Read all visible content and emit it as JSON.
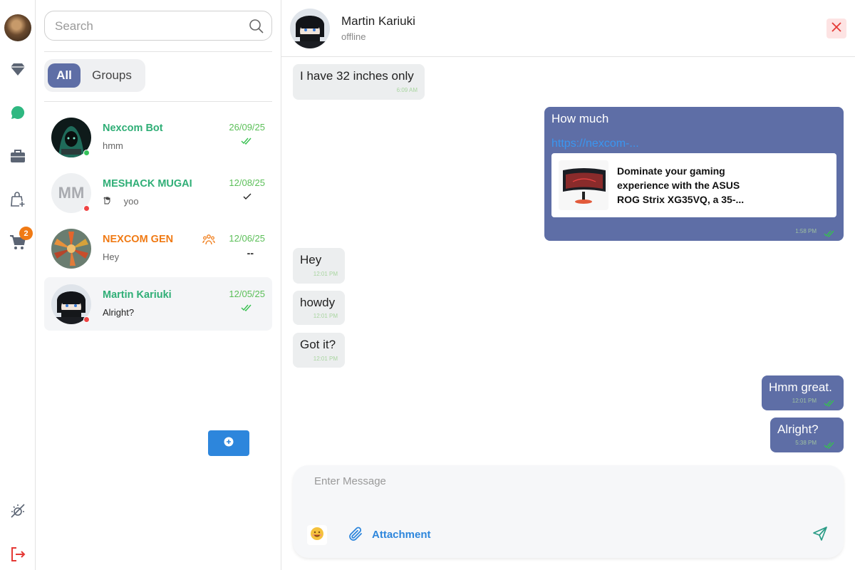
{
  "rail": {
    "cart_badge": "2"
  },
  "search": {
    "placeholder": "Search"
  },
  "tabs": {
    "all": "All",
    "groups": "Groups"
  },
  "chats": [
    {
      "name": "Nexcom Bot",
      "message": "hmm",
      "date": "26/09/25",
      "status": "read",
      "presence": "online",
      "name_color": "#2fae76"
    },
    {
      "name": "MESHACK MUGAI",
      "initials": "MM",
      "message": "yoo",
      "date": "12/08/25",
      "status": "sent",
      "presence": "offline",
      "name_color": "#2fae76"
    },
    {
      "name": "NEXCOM GEN",
      "message": "Hey",
      "date": "12/06/25",
      "status": "--",
      "is_group": true,
      "name_color": "#f07a14"
    },
    {
      "name": "Martin Kariuki",
      "message": "Alright?",
      "date": "12/05/25",
      "status": "read",
      "presence": "offline",
      "name_color": "#2fae76",
      "active": true
    }
  ],
  "conversation": {
    "contact_name": "Martin Kariuki",
    "contact_status": "offline",
    "messages": [
      {
        "dir": "in",
        "text": "I have 32 inches only",
        "time": "6:09 AM"
      },
      {
        "dir": "out",
        "text": "How much",
        "link": "https://nexcom-...",
        "preview_text": "Dominate your gaming experience with the ASUS ROG Strix XG35VQ, a 35-...",
        "time": "1:58 PM"
      },
      {
        "dir": "in",
        "text": "Hey",
        "time": "12:01 PM"
      },
      {
        "dir": "in",
        "text": "howdy",
        "time": "12:01 PM"
      },
      {
        "dir": "in",
        "text": "Got it?",
        "time": "12:01 PM"
      },
      {
        "dir": "out",
        "text": "Hmm great.",
        "time": "12:01 PM"
      },
      {
        "dir": "out",
        "text": "Alright?",
        "time": "5:38 PM"
      }
    ]
  },
  "composer": {
    "placeholder": "Enter Message",
    "attachment_label": "Attachment"
  },
  "colors": {
    "accent": "#5e6ea6",
    "green": "#2fae76",
    "orange": "#f07a14",
    "blue": "#2d86dc",
    "danger": "#e53935"
  }
}
